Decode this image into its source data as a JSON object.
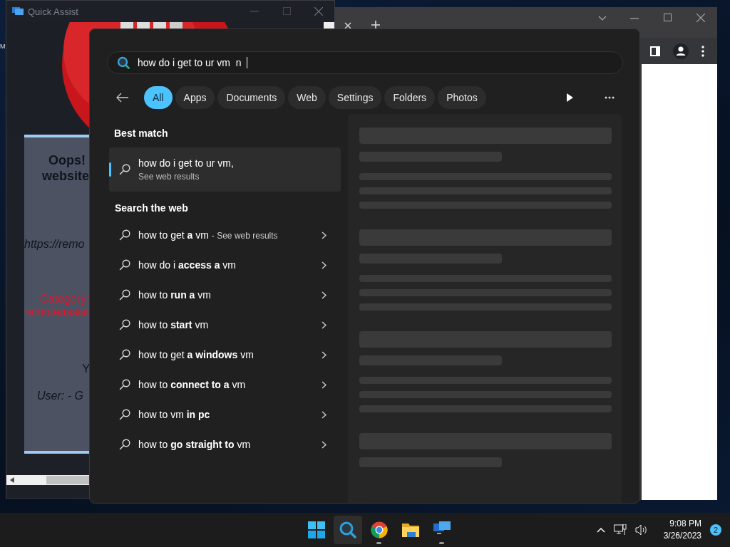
{
  "desktop": {
    "label_fragment": "M"
  },
  "quick_assist": {
    "title": "Quick Assist",
    "page": {
      "heading_1": "Oops!",
      "heading_2": "website",
      "url": "https://remo",
      "category_1": "Category:",
      "category_2": "remoteassist",
      "line_fragment": "Y",
      "user_line": "User: -   G"
    }
  },
  "search": {
    "query": "how do i get to ur vm  n",
    "filters": [
      {
        "label": "All",
        "selected": true
      },
      {
        "label": "Apps",
        "selected": false
      },
      {
        "label": "Documents",
        "selected": false
      },
      {
        "label": "Web",
        "selected": false
      },
      {
        "label": "Settings",
        "selected": false
      },
      {
        "label": "Folders",
        "selected": false
      },
      {
        "label": "Photos",
        "selected": false
      }
    ],
    "best_match": {
      "heading": "Best match",
      "title": "how do i get to ur vm,",
      "subtitle": "See web results",
      "selected": true
    },
    "web": {
      "heading": "Search the web",
      "items": [
        {
          "text": "how to get **a** vm",
          "suffix": "- See web results"
        },
        {
          "text": "how do i **access a** vm"
        },
        {
          "text": "how to **run a** vm"
        },
        {
          "text": "how to **start** vm"
        },
        {
          "text": "how to get **a windows** vm"
        },
        {
          "text": "how to **connect to a** vm"
        },
        {
          "text": "how to vm **in pc**"
        },
        {
          "text": "how to **go straight to** vm"
        }
      ]
    }
  },
  "taskbar": {
    "apps": [
      {
        "kind": "start",
        "selected": false,
        "running": false
      },
      {
        "kind": "search",
        "selected": true,
        "running": false
      },
      {
        "kind": "browser",
        "selected": false,
        "running": true
      },
      {
        "kind": "folder",
        "selected": false,
        "running": false
      },
      {
        "kind": "remote",
        "selected": false,
        "running": true
      }
    ],
    "time": "9:08 PM",
    "date": "3/26/2023",
    "notifications": "2"
  }
}
